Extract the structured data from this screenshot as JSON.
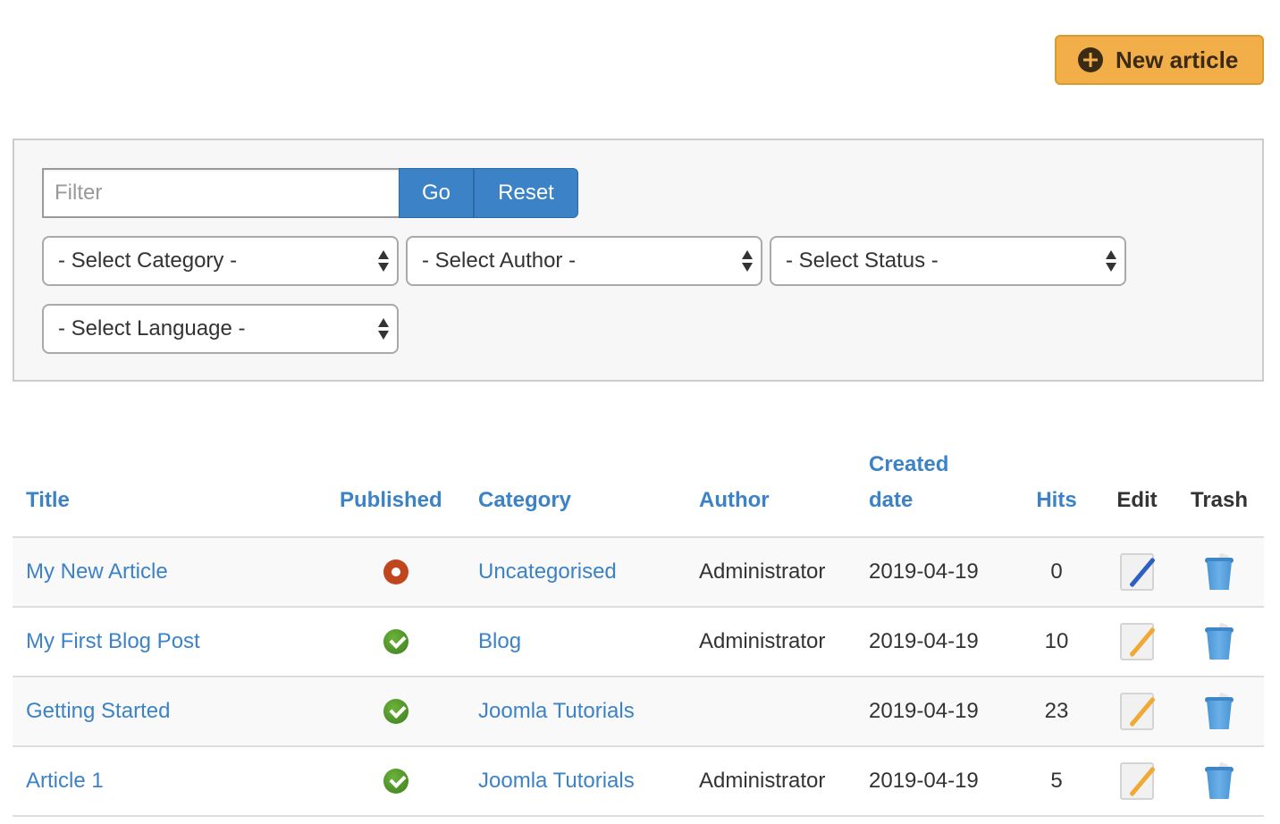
{
  "toolbar": {
    "new_article_label": "New article",
    "new_article_icon": "plus-circle-icon"
  },
  "filters": {
    "search_placeholder": "Filter",
    "search_value": "",
    "go_label": "Go",
    "reset_label": "Reset",
    "category_selected": "- Select Category -",
    "author_selected": "- Select Author -",
    "status_selected": "- Select Status -",
    "language_selected": "- Select Language -"
  },
  "table": {
    "headers": {
      "title": "Title",
      "published": "Published",
      "category": "Category",
      "author": "Author",
      "created_date": "Created date",
      "hits": "Hits",
      "edit": "Edit",
      "trash": "Trash"
    },
    "rows": [
      {
        "title": "My New Article",
        "published": false,
        "status_icon": "unpublished-icon",
        "category": "Uncategorised",
        "author": "Administrator",
        "created": "2019-04-19",
        "hits": "0",
        "edit_icon": "edit-icon-checked-out"
      },
      {
        "title": "My First Blog Post",
        "published": true,
        "status_icon": "published-icon",
        "category": "Blog",
        "author": "Administrator",
        "created": "2019-04-19",
        "hits": "10",
        "edit_icon": "edit-icon"
      },
      {
        "title": "Getting Started",
        "published": true,
        "status_icon": "published-icon",
        "category": "Joomla Tutorials",
        "author": "",
        "created": "2019-04-19",
        "hits": "23",
        "edit_icon": "edit-icon"
      },
      {
        "title": "Article 1",
        "published": true,
        "status_icon": "published-icon",
        "category": "Joomla Tutorials",
        "author": "Administrator",
        "created": "2019-04-19",
        "hits": "5",
        "edit_icon": "edit-icon"
      }
    ]
  },
  "colors": {
    "accent": "#3b82c6",
    "new_button": "#f2ae48",
    "published": "#4a8f26",
    "unpublished": "#c0471d"
  }
}
